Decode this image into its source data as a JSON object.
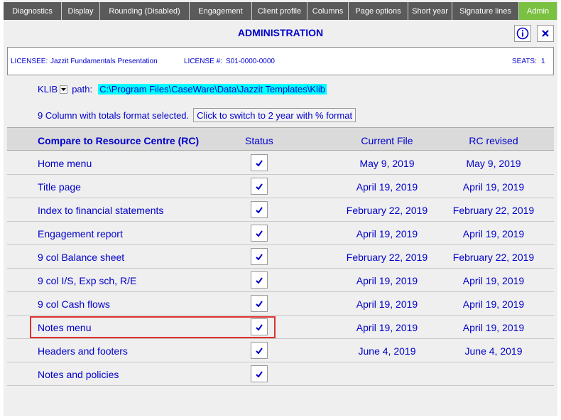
{
  "tabs": [
    {
      "label": "Diagnostics",
      "active": false
    },
    {
      "label": "Display",
      "active": false
    },
    {
      "label": "Rounding (Disabled)",
      "active": false
    },
    {
      "label": "Engagement",
      "active": false
    },
    {
      "label": "Client profile",
      "active": false
    },
    {
      "label": "Columns",
      "active": false
    },
    {
      "label": "Page options",
      "active": false
    },
    {
      "label": "Short year",
      "active": false
    },
    {
      "label": "Signature lines",
      "active": false
    },
    {
      "label": "Admin",
      "active": true
    }
  ],
  "page": {
    "title": "ADMINISTRATION"
  },
  "license": {
    "licensee_label": "LICENSEE:",
    "licensee_value": "Jazzit Fundamentals Presentation",
    "license_label": "LICENSE #:",
    "license_value": "S01-0000-0000",
    "seats_label": "SEATS:",
    "seats_value": "1"
  },
  "klib": {
    "label": "KLIB",
    "path_label": "path:",
    "path_value": "C:\\Program Files\\CaseWare\\Data\\Jazzit Templates\\Klib"
  },
  "format": {
    "text": "9 Column with totals format selected.",
    "button_label": "Click to switch to 2 year with % format"
  },
  "table": {
    "headers": {
      "name": "Compare to Resource Centre (RC)",
      "status": "Status",
      "current": "Current File",
      "rc": "RC revised"
    },
    "rows": [
      {
        "name": "Home menu",
        "current": "May 9, 2019",
        "rc": "May 9, 2019"
      },
      {
        "name": "Title page",
        "current": "April 19, 2019",
        "rc": "April 19, 2019"
      },
      {
        "name": "Index to financial statements",
        "current": "February 22, 2019",
        "rc": "February 22, 2019"
      },
      {
        "name": "Engagement report",
        "current": "April 19, 2019",
        "rc": "April 19, 2019"
      },
      {
        "name": "9 col Balance sheet",
        "current": "February 22, 2019",
        "rc": "February 22, 2019"
      },
      {
        "name": "9 col I/S, Exp sch, R/E",
        "current": "April 19, 2019",
        "rc": "April 19, 2019"
      },
      {
        "name": "9 col Cash flows",
        "current": "April 19, 2019",
        "rc": "April 19, 2019"
      },
      {
        "name": "Notes menu",
        "current": "April 19, 2019",
        "rc": "April 19, 2019"
      },
      {
        "name": "Headers and footers",
        "current": "June 4, 2019",
        "rc": "June 4, 2019"
      },
      {
        "name": "Notes and policies",
        "current": "",
        "rc": ""
      }
    ]
  },
  "colors": {
    "accent": "#0000cc",
    "tab_bg": "#5a5a5a",
    "tab_active": "#7ac142",
    "path_highlight": "#00ffff",
    "selection_outline": "#e03030"
  },
  "icons": {
    "info": "info-icon",
    "close": "close-icon",
    "check": "check-icon",
    "dropdown": "dropdown-arrow-icon"
  }
}
